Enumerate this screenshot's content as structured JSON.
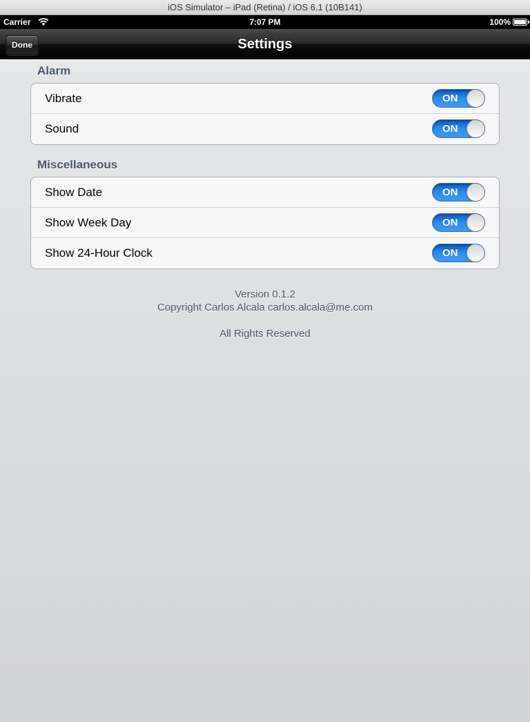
{
  "window": {
    "title": "iOS Simulator – iPad (Retina) / iOS 6.1 (10B141)"
  },
  "status_bar": {
    "carrier": "Carrier",
    "time": "7:07 PM",
    "battery": "100%",
    "wifi_icon": "wifi-icon",
    "battery_icon": "battery-icon"
  },
  "navbar": {
    "title": "Settings",
    "done_label": "Done"
  },
  "sections": [
    {
      "header": "Alarm",
      "rows": [
        {
          "label": "Vibrate",
          "switch": "ON",
          "on": true
        },
        {
          "label": "Sound",
          "switch": "ON",
          "on": true
        }
      ]
    },
    {
      "header": "Miscellaneous",
      "rows": [
        {
          "label": "Show Date",
          "switch": "ON",
          "on": true
        },
        {
          "label": "Show Week Day",
          "switch": "ON",
          "on": true
        },
        {
          "label": "Show 24-Hour Clock",
          "switch": "ON",
          "on": true
        }
      ]
    }
  ],
  "footer": {
    "version": "Version 0.1.2",
    "copyright": "Copyright Carlos Alcala carlos.alcala@me.com",
    "rights": "All Rights Reserved"
  },
  "colors": {
    "switch_on": "#2a8cf0",
    "section_header": "#4c566c",
    "background": "#e5e7ea"
  }
}
